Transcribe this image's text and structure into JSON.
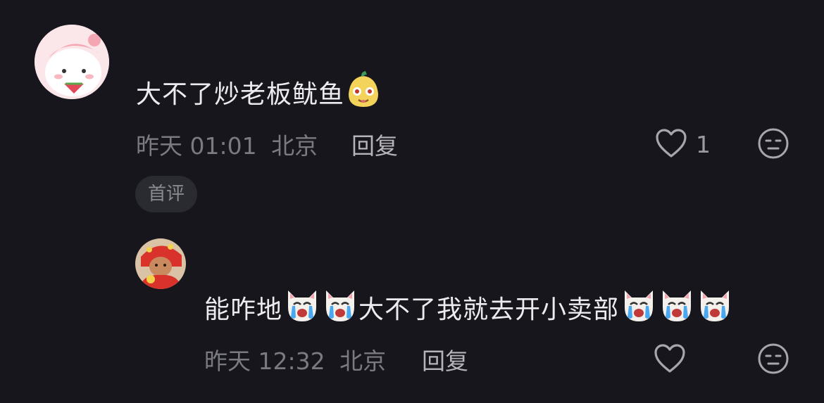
{
  "comment": {
    "text": "大不了炒老板鱿鱼",
    "time": "昨天 01:01",
    "location": "北京",
    "reply_label": "回复",
    "like_count": "1",
    "badge": "首评"
  },
  "reply": {
    "text_before": "能咋地",
    "text_middle": "大不了我就去开小卖部",
    "time": "昨天 12:32",
    "location": "北京",
    "reply_label": "回复"
  },
  "icons": {
    "like": "heart-outline-icon",
    "dislike": "meh-face-icon",
    "crying": "crying-cat-emoji",
    "cheeky": "cheeky-pear-emoji"
  },
  "colors": {
    "background": "#16161c",
    "primary_text": "#ececf0",
    "secondary_text": "#7a7a82"
  }
}
